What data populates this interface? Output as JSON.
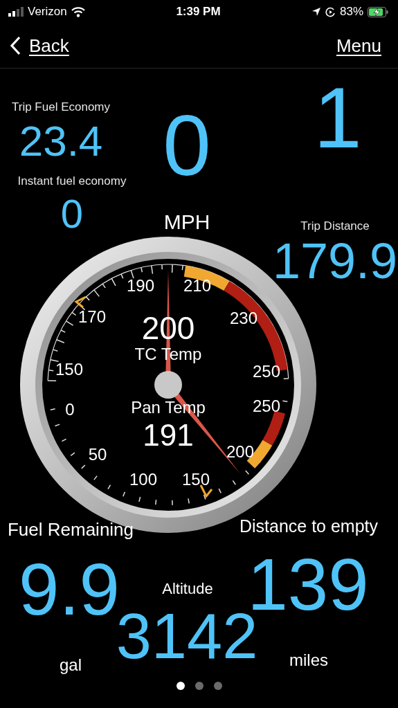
{
  "status_bar": {
    "carrier": "Verizon",
    "time": "1:39 PM",
    "battery": "83%"
  },
  "nav": {
    "back": "Back",
    "menu": "Menu"
  },
  "readouts": [
    {
      "kind": "label",
      "text": "Trip Fuel Economy"
    },
    {
      "kind": "value",
      "text": "23.4"
    },
    {
      "kind": "label",
      "text": "Instant fuel economy"
    },
    {
      "kind": "value",
      "text": "0"
    },
    {
      "kind": "value",
      "text": "0"
    },
    {
      "kind": "value",
      "text": "1"
    },
    {
      "kind": "caption",
      "text": "MPH"
    },
    {
      "kind": "label",
      "text": "Trip Distance"
    },
    {
      "kind": "value",
      "text": "179.9"
    },
    {
      "kind": "caption",
      "text": "Fuel Remaining"
    },
    {
      "kind": "caption",
      "text": "Distance to empty"
    },
    {
      "kind": "value",
      "text": "9.9"
    },
    {
      "kind": "caption",
      "text": "Altitude"
    },
    {
      "kind": "value",
      "text": "139"
    },
    {
      "kind": "value",
      "text": "3142"
    },
    {
      "kind": "caption",
      "text": "gal"
    },
    {
      "kind": "caption",
      "text": "miles"
    }
  ],
  "gauge": {
    "top_value": "200",
    "top_label": "TC Temp",
    "bottom_label": "Pan Temp",
    "bottom_value": "191",
    "scale_labels": [
      "190",
      "210",
      "170",
      "230",
      "150",
      "250",
      "0",
      "250",
      "50",
      "200",
      "100",
      "150"
    ]
  },
  "page_dots": [
    {
      "selected": true
    },
    {
      "selected": false
    },
    {
      "selected": false
    }
  ]
}
